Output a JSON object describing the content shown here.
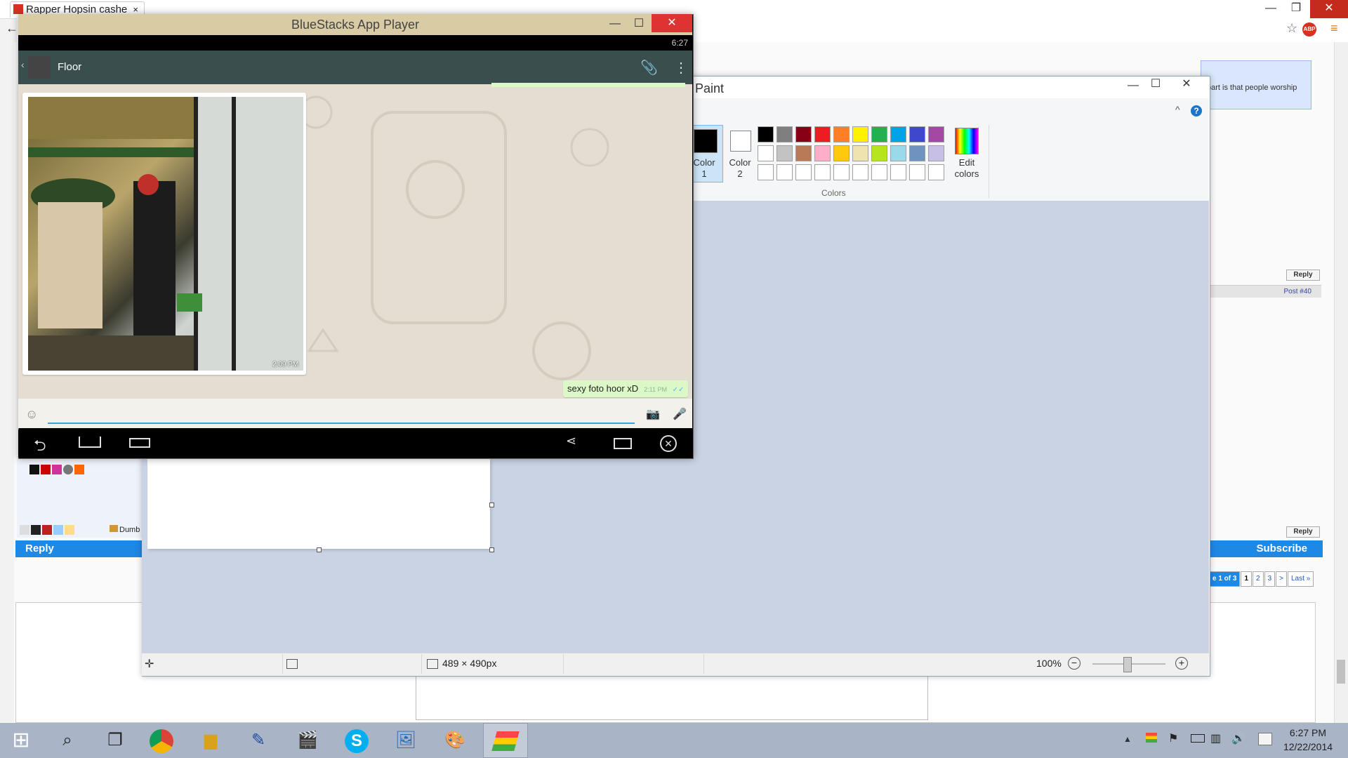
{
  "browser": {
    "tab_title": "Rapper Hopsin cashe",
    "tab_close": "×",
    "minimize": "—",
    "restore": "❐",
    "close": "✕",
    "back": "←",
    "star": "☆",
    "abp": "ABP",
    "menu": "≡"
  },
  "forum": {
    "quote_text": "part is that people worship",
    "reply_small_1": "Reply",
    "post_label": "Post #40",
    "reply_small_2": "Reply",
    "subscribe": "Subscribe",
    "reply": "Reply",
    "left_panel_label": "Dumb",
    "pager": {
      "label": "e 1 of 3",
      "pages": [
        "1",
        "2",
        "3",
        ">"
      ],
      "last": "Last »"
    }
  },
  "paint": {
    "title": "Paint",
    "minimize": "—",
    "maximize": "☐",
    "close": "✕",
    "collapse": "^",
    "help": "?",
    "color1_label": "Color\n1",
    "color2_label": "Color\n2",
    "edit_colors_label": "Edit\ncolors",
    "colors_group": "Colors",
    "palette": [
      "#000000",
      "#7f7f7f",
      "#880015",
      "#ed1c24",
      "#ff7f27",
      "#fff200",
      "#22b14c",
      "#00a2e8",
      "#3f48cc",
      "#a349a4",
      "#ffffff",
      "#c3c3c3",
      "#b97a57",
      "#ffaec9",
      "#ffc90e",
      "#efe4b0",
      "#b5e61d",
      "#99d9ea",
      "#7092be",
      "#c8bfe7",
      "#ffffff",
      "#ffffff",
      "#ffffff",
      "#ffffff",
      "#ffffff",
      "#ffffff",
      "#ffffff",
      "#ffffff",
      "#ffffff",
      "#ffffff"
    ],
    "status": {
      "size": "489 × 490px",
      "zoom": "100%",
      "zoom_out": "−",
      "zoom_in": "+"
    }
  },
  "bluestacks": {
    "title": "BlueStacks App Player",
    "minimize": "—",
    "maximize": "☐",
    "close": "✕",
    "clock": "6:27",
    "chat": {
      "contact": "Floor",
      "photo_time": "2:09 PM",
      "outgoing_text": "sexy foto hoor xD",
      "outgoing_time": "2:11 PM",
      "ticks": "✓✓"
    }
  },
  "taskbar": {
    "time": "6:27 PM",
    "date": "12/22/2014"
  }
}
